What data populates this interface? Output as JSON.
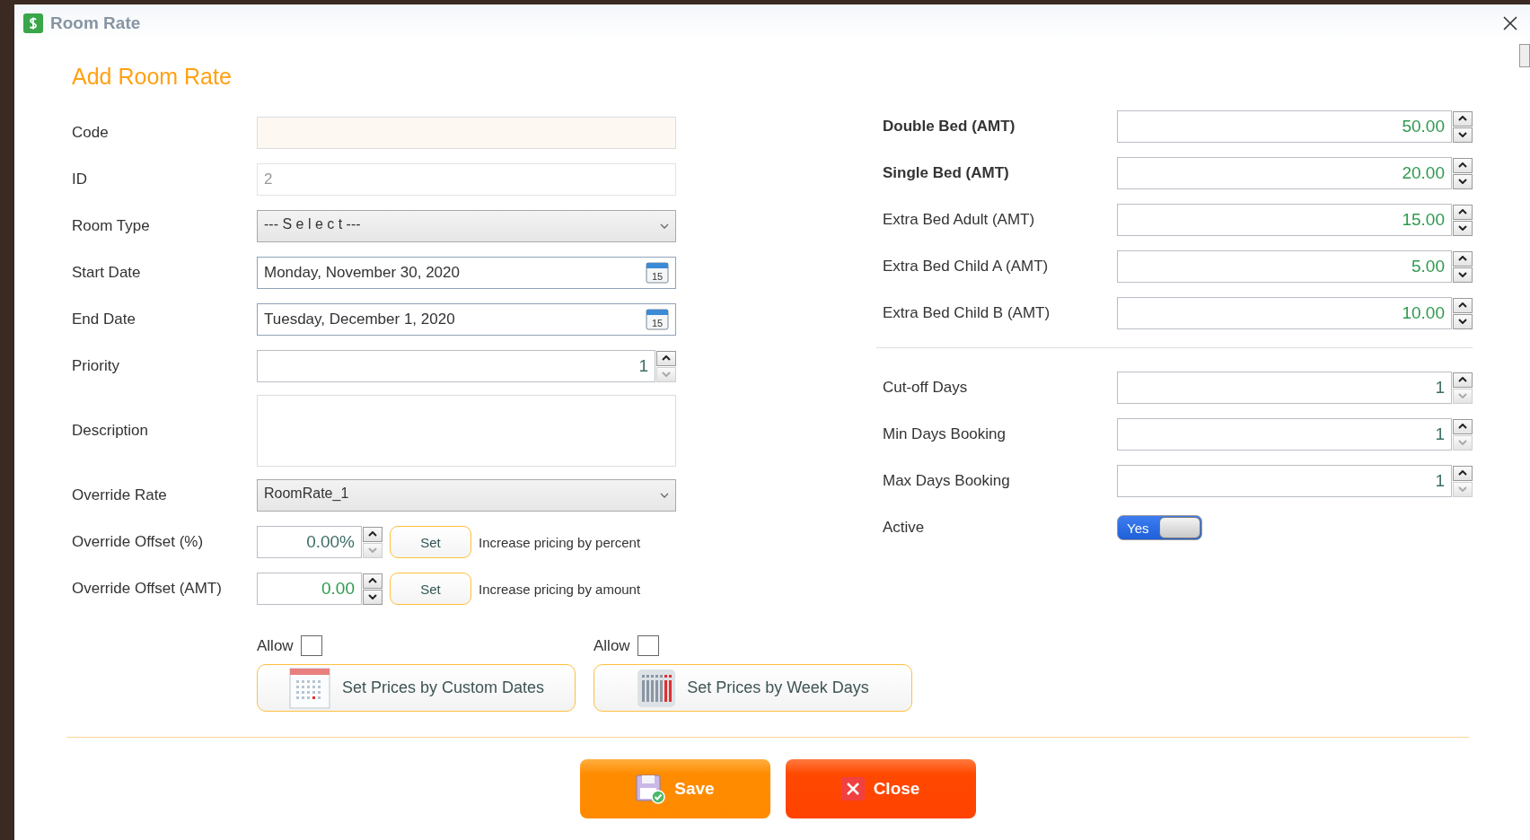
{
  "window": {
    "title": "Room Rate"
  },
  "heading": "Add Room Rate",
  "left_fields": [
    {
      "kind": "text",
      "label": "Code",
      "highlighted": true
    },
    {
      "kind": "readonly",
      "label": "ID",
      "value": "2"
    },
    {
      "kind": "select",
      "label": "Room Type",
      "value": "--- S e l e c t ---"
    },
    {
      "kind": "date",
      "label": "Start Date",
      "value": "Monday, November 30, 2020",
      "icon_text": "15"
    },
    {
      "kind": "date",
      "label": "End Date",
      "value": "Tuesday, December 1, 2020",
      "icon_text": "15"
    },
    {
      "kind": "spin",
      "label": "Priority",
      "value": "1",
      "down_enabled": false
    },
    {
      "kind": "textarea",
      "label": "Description"
    },
    {
      "kind": "select",
      "label": "Override Rate",
      "value": "RoomRate_1"
    },
    {
      "kind": "offset_percent",
      "label": "Override Offset (%)",
      "value": "0.00%",
      "down_enabled": false,
      "button": "Set",
      "hint": "Increase pricing by percent"
    },
    {
      "kind": "offset_amount",
      "label": "Override Offset (AMT)",
      "value": "0.00",
      "down_enabled": true,
      "button": "Set",
      "hint": "Increase pricing by amount"
    }
  ],
  "price_buttons": [
    {
      "allow_label": "Allow",
      "checked": false,
      "label": "Set Prices by Custom Dates",
      "kind": "calendar"
    },
    {
      "allow_label": "Allow",
      "checked": false,
      "label": "Set Prices by Week Days",
      "kind": "week"
    }
  ],
  "amounts": [
    {
      "label": "Double Bed (AMT)",
      "bold": true,
      "value": "50.00"
    },
    {
      "label": "Single Bed (AMT)",
      "bold": true,
      "value": "20.00"
    },
    {
      "label": "Extra Bed Adult (AMT)",
      "bold": false,
      "value": "15.00"
    },
    {
      "label": "Extra Bed Child A (AMT)",
      "bold": false,
      "value": "5.00"
    },
    {
      "label": "Extra Bed Child B (AMT)",
      "bold": false,
      "value": "10.00"
    }
  ],
  "days": [
    {
      "label": "Cut-off Days",
      "value": "1",
      "down_enabled": false
    },
    {
      "label": "Min Days Booking",
      "value": "1",
      "down_enabled": false
    },
    {
      "label": "Max Days Booking",
      "value": "1",
      "down_enabled": false
    }
  ],
  "active": {
    "label": "Active",
    "on": true,
    "text": "Yes"
  },
  "footer_buttons": [
    {
      "kind": "save",
      "label": "Save"
    },
    {
      "kind": "close",
      "label": "Close"
    }
  ]
}
